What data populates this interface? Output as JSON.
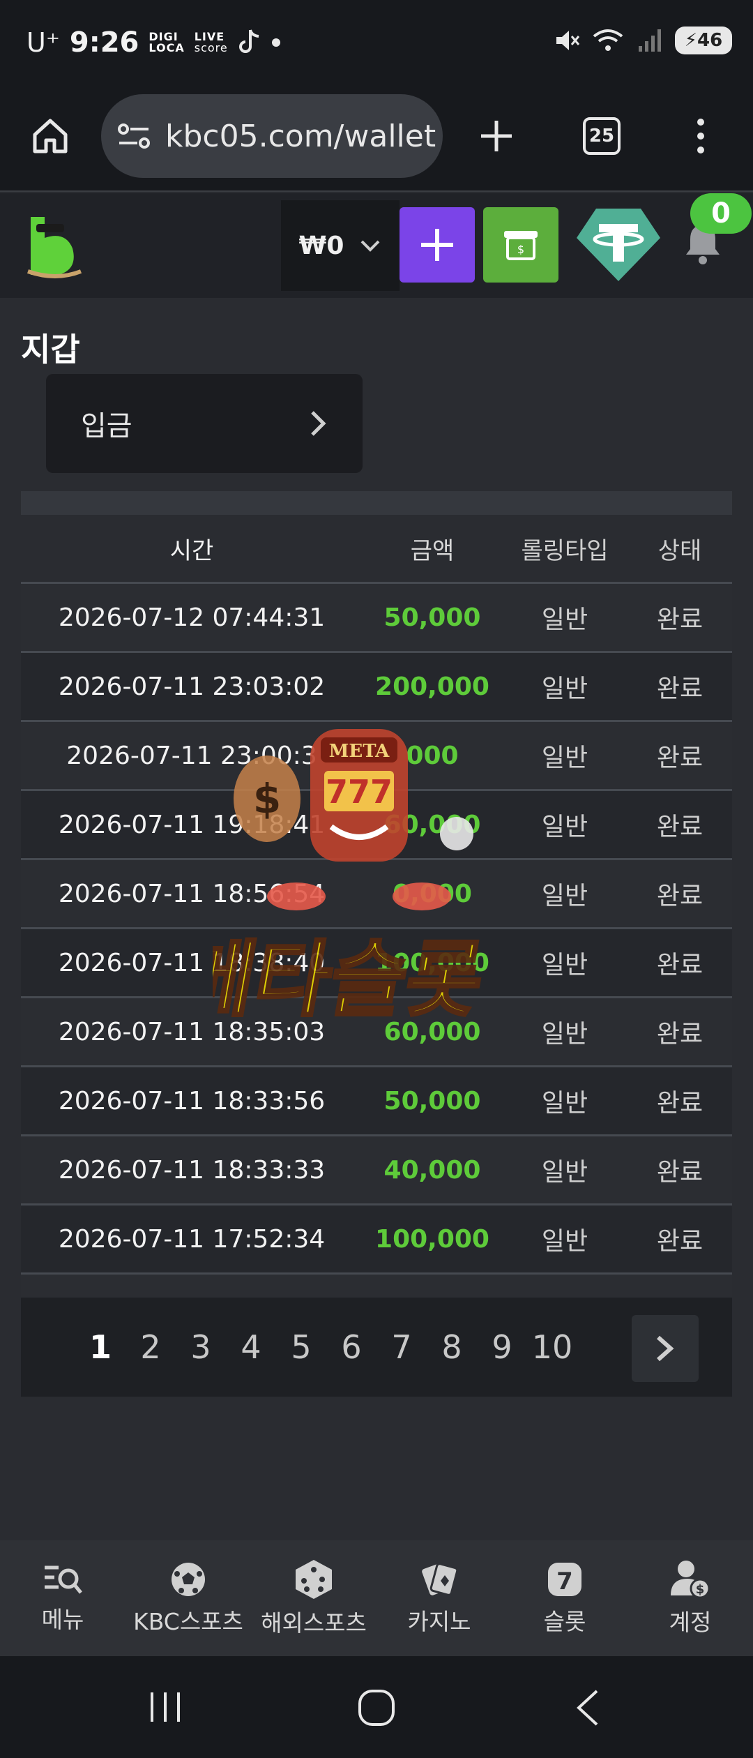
{
  "status_bar": {
    "carrier": "U⁺",
    "time": "9:26",
    "app_logo_1_top": "DIGI",
    "app_logo_1_bottom": "LOCA",
    "app_logo_2_top": "LIVE",
    "app_logo_2_bottom": "score",
    "battery": "46"
  },
  "browser": {
    "url": "kbc05.com/wallet",
    "tab_count": "25"
  },
  "header": {
    "balance": "₩0",
    "notification_count": "0"
  },
  "page": {
    "title": "지갑",
    "deposit_label": "입금"
  },
  "table": {
    "headers": {
      "time": "시간",
      "amount": "금액",
      "rolling": "롤링타입",
      "status": "상태"
    },
    "rows": [
      {
        "time": "2026-07-12 07:44:31",
        "amount": "50,000",
        "rolling": "일반",
        "status": "완료"
      },
      {
        "time": "2026-07-11 23:03:02",
        "amount": "200,000",
        "rolling": "일반",
        "status": "완료"
      },
      {
        "time": "2026-07-11 23:00:3",
        "amount": "000",
        "rolling": "일반",
        "status": "완료"
      },
      {
        "time": "2026-07-11 19:18:41",
        "amount": "60,000",
        "rolling": "일반",
        "status": "완료"
      },
      {
        "time": "2026-07-11 18:56:54",
        "amount": "0,000",
        "rolling": "일반",
        "status": "완료"
      },
      {
        "time": "2026-07-11 18:38:40",
        "amount": "100,000",
        "rolling": "일반",
        "status": "완료"
      },
      {
        "time": "2026-07-11 18:35:03",
        "amount": "60,000",
        "rolling": "일반",
        "status": "완료"
      },
      {
        "time": "2026-07-11 18:33:56",
        "amount": "50,000",
        "rolling": "일반",
        "status": "완료"
      },
      {
        "time": "2026-07-11 18:33:33",
        "amount": "40,000",
        "rolling": "일반",
        "status": "완료"
      },
      {
        "time": "2026-07-11 17:52:34",
        "amount": "100,000",
        "rolling": "일반",
        "status": "완료"
      }
    ]
  },
  "pagination": {
    "pages": [
      "1",
      "2",
      "3",
      "4",
      "5",
      "6",
      "7",
      "8",
      "9",
      "10"
    ],
    "active": "1"
  },
  "watermark": {
    "sign": "META",
    "reels": "777",
    "logo_text": "메타슬롯"
  },
  "bottom_nav": [
    {
      "label": "메뉴",
      "icon": "menu-search-icon"
    },
    {
      "label": "KBC스포츠",
      "icon": "soccer-ball-icon"
    },
    {
      "label": "해외스포츠",
      "icon": "dice-icon"
    },
    {
      "label": "카지노",
      "icon": "cards-icon"
    },
    {
      "label": "슬롯",
      "icon": "slot-seven-icon"
    },
    {
      "label": "계정",
      "icon": "account-icon"
    }
  ],
  "colors": {
    "accent_green": "#5ecb3a",
    "purple": "#7b44e8",
    "cash_green": "#5cae3c",
    "tether": "#50af95"
  }
}
